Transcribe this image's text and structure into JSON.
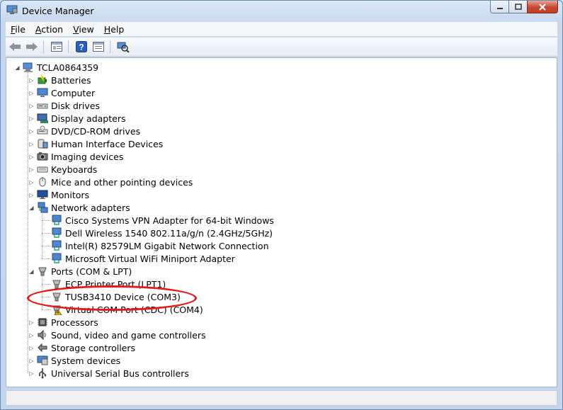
{
  "window": {
    "title": "Device Manager",
    "caption": {
      "minimize": "0",
      "maximize": "1",
      "close": "r"
    }
  },
  "menu": [
    {
      "label": "File",
      "mnemonic": "F"
    },
    {
      "label": "Action",
      "mnemonic": "A"
    },
    {
      "label": "View",
      "mnemonic": "V"
    },
    {
      "label": "Help",
      "mnemonic": "H"
    }
  ],
  "toolbar": [
    "back-icon",
    "forward-icon",
    "properties-view-icon",
    "help-icon",
    "update-driver-icon",
    "scan-hardware-icon"
  ],
  "tree": {
    "root": "TCLA0864359",
    "categories": [
      {
        "label": "Batteries",
        "icon": "battery-icon"
      },
      {
        "label": "Computer",
        "icon": "computer-icon"
      },
      {
        "label": "Disk drives",
        "icon": "disk-drive-icon"
      },
      {
        "label": "Display adapters",
        "icon": "display-adapter-icon"
      },
      {
        "label": "DVD/CD-ROM drives",
        "icon": "dvd-drive-icon"
      },
      {
        "label": "Human Interface Devices",
        "icon": "hid-icon"
      },
      {
        "label": "Imaging devices",
        "icon": "camera-icon"
      },
      {
        "label": "Keyboards",
        "icon": "keyboard-icon"
      },
      {
        "label": "Mice and other pointing devices",
        "icon": "mouse-icon"
      },
      {
        "label": "Monitors",
        "icon": "monitor-icon"
      },
      {
        "label": "Network adapters",
        "icon": "network-adapter-icon",
        "expanded": true,
        "children": [
          "Cisco Systems VPN Adapter for 64-bit Windows",
          "Dell Wireless 1540 802.11a/g/n (2.4GHz/5GHz)",
          "Intel(R) 82579LM Gigabit Network Connection",
          "Microsoft Virtual WiFi Miniport Adapter"
        ]
      },
      {
        "label": "Ports (COM & LPT)",
        "icon": "port-icon",
        "expanded": true,
        "children": [
          "ECP Printer Port (LPT1)",
          "TUSB3410 Device (COM3)",
          "Virtual COM Port (CDC) (COM4)"
        ]
      },
      {
        "label": "Processors",
        "icon": "processor-icon"
      },
      {
        "label": "Sound, video and game controllers",
        "icon": "speaker-icon"
      },
      {
        "label": "Storage controllers",
        "icon": "storage-controller-icon"
      },
      {
        "label": "System devices",
        "icon": "system-device-icon"
      },
      {
        "label": "Universal Serial Bus controllers",
        "icon": "usb-icon"
      }
    ]
  },
  "highlight": {
    "target": "TUSB3410 Device (COM3)",
    "color": "#e41a1a"
  },
  "warning_color": "#f2c200"
}
